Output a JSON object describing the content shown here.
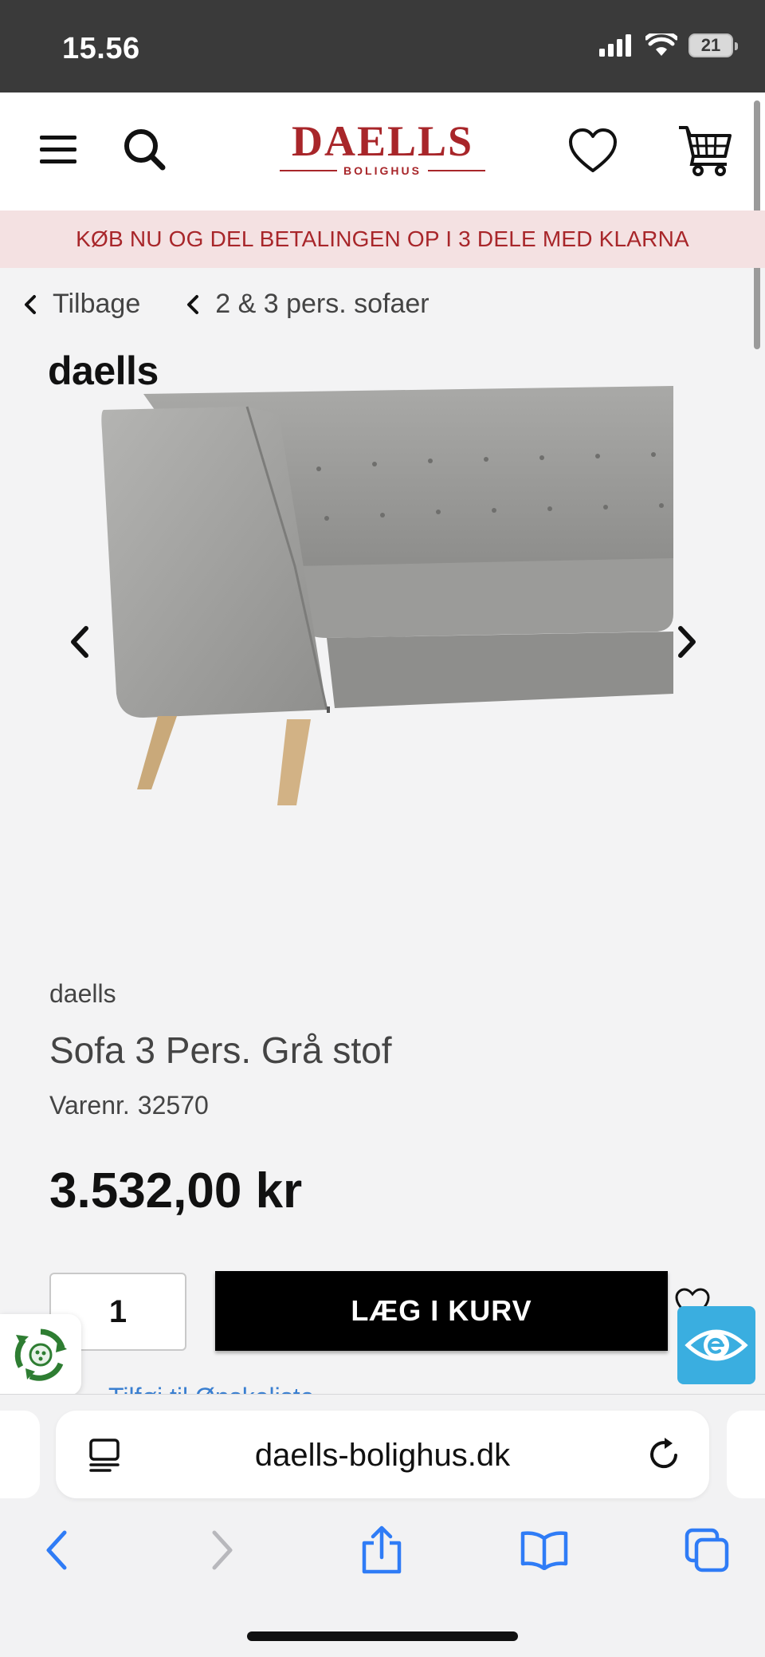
{
  "status_bar": {
    "time": "15.56",
    "battery": "21"
  },
  "header": {
    "logo_main": "DAELLS",
    "logo_sub": "BOLIGHUS"
  },
  "promo": {
    "text": "KØB NU OG DEL BETALINGEN OP I 3 DELE MED KLARNA"
  },
  "breadcrumb": {
    "back": "Tilbage",
    "category": "2 & 3 pers. sofaer"
  },
  "product": {
    "image_brand": "daells",
    "brand": "daells",
    "title": "Sofa 3 Pers. Grå stof",
    "sku_label": "Varenr.",
    "sku": "32570",
    "price": "3.532,00 kr",
    "quantity": "1",
    "add_to_cart": "LÆG I KURV",
    "partial_link": "Tilføj til Ønskeliste"
  },
  "browser": {
    "url": "daells-bolighus.dk"
  },
  "colors": {
    "brand_red": "#a8262a",
    "promo_bg": "#f4e1e2",
    "accessibility_blue": "#3aaee0",
    "ios_blue": "#2f7cf6"
  },
  "icons": [
    "menu-icon",
    "search-icon",
    "heart-icon",
    "cart-icon",
    "chevron-left-icon",
    "chevron-right-icon",
    "recycle-icon",
    "eye-icon",
    "reader-icon",
    "reload-icon",
    "back-icon",
    "forward-icon",
    "share-icon",
    "bookmarks-icon",
    "tabs-icon"
  ]
}
